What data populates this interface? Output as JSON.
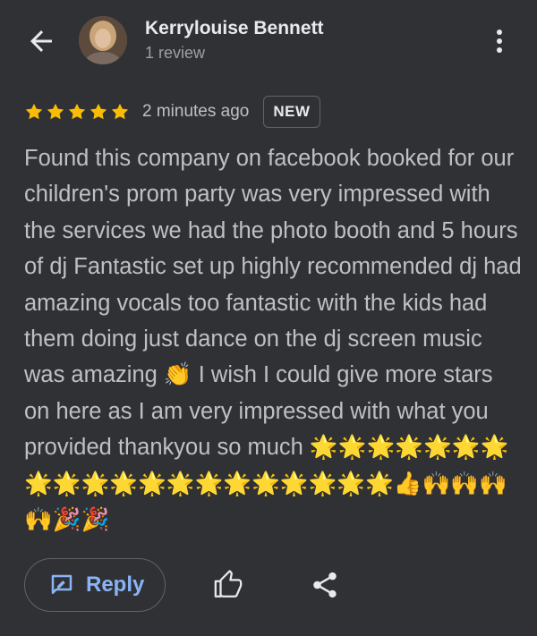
{
  "reviewer": {
    "name": "Kerrylouise Bennett",
    "review_count": "1 review"
  },
  "review": {
    "rating": 5,
    "time": "2 minutes ago",
    "badge": "NEW",
    "text": "Found this company on facebook booked for our children's prom party was very impressed with the services we had the photo booth and 5 hours of dj Fantastic set up highly recommended dj had amazing vocals too fantastic with the kids had them doing just dance on the dj screen music was amazing 👏 I wish I could give more stars on here as I am very impressed with what you provided thankyou so much 🌟🌟🌟🌟🌟🌟🌟🌟🌟🌟🌟🌟🌟🌟🌟🌟🌟🌟🌟🌟👍🙌🙌🙌🙌🎉🎉"
  },
  "actions": {
    "reply_label": "Reply"
  },
  "icons": {
    "back": "arrow-back-icon",
    "more": "more-vert-icon",
    "reply": "reply-edit-icon",
    "like": "thumb-up-icon",
    "share": "share-icon"
  },
  "colors": {
    "background": "#303134",
    "star": "#fbbc04",
    "accent": "#8ab4f8",
    "text_primary": "#e8eaed",
    "text_secondary": "#bdc1c6"
  }
}
